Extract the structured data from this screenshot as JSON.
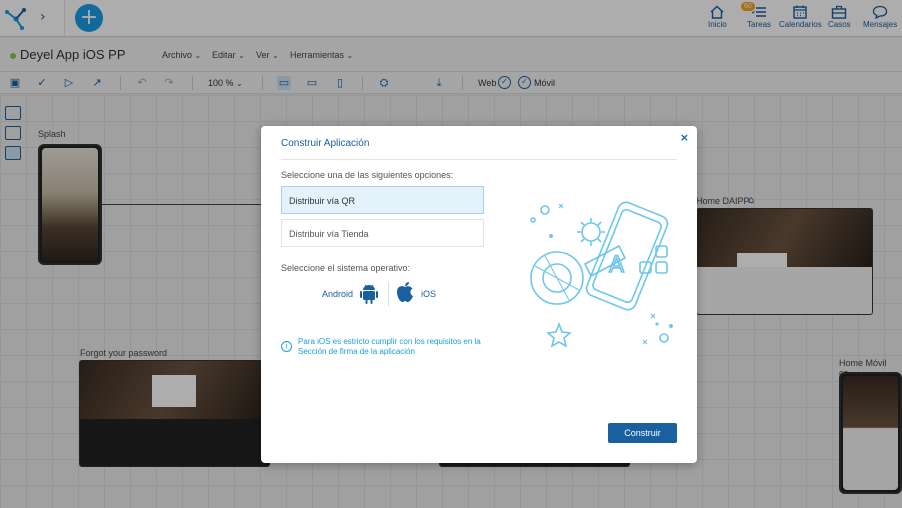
{
  "topnav": {
    "items": [
      {
        "label": "Inicio",
        "icon": "home-icon"
      },
      {
        "label": "Tareas",
        "icon": "tasks-icon",
        "badge": "60"
      },
      {
        "label": "Calendarios",
        "icon": "calendar-icon"
      },
      {
        "label": "Casos",
        "icon": "briefcase-icon"
      },
      {
        "label": "Mensajes",
        "icon": "chat-icon"
      }
    ]
  },
  "appbar": {
    "title": "Deyel App iOS PP",
    "menus": [
      "Archivo",
      "Editar",
      "Ver",
      "Herramientas"
    ]
  },
  "toolbar": {
    "zoom": "100 %",
    "web_label": "Web",
    "mobile_label": "Móvil"
  },
  "canvas": {
    "nodes": {
      "splash": "Splash",
      "forgot": "Forgot your password",
      "home_daipp": "Home DAIPP",
      "home_movil": "Home Móvil co..."
    }
  },
  "modal": {
    "title": "Construir Aplicación",
    "prompt_options": "Seleccione una de las siguientes opciones:",
    "options": [
      "Distribuir vía QR",
      "Distribuir vía Tienda"
    ],
    "prompt_os": "Seleccione el sistema operativo:",
    "os": {
      "android": "Android",
      "ios": "iOS"
    },
    "info": "Para iOS es estricto cumplir con los requisitos en la Sección de firma de la aplicación",
    "build_label": "Construir"
  },
  "colors": {
    "brand": "#1a5fa0",
    "accent": "#1a9be6",
    "selected_bg": "#e4f3fb",
    "illustration": "#6ec6ea"
  }
}
